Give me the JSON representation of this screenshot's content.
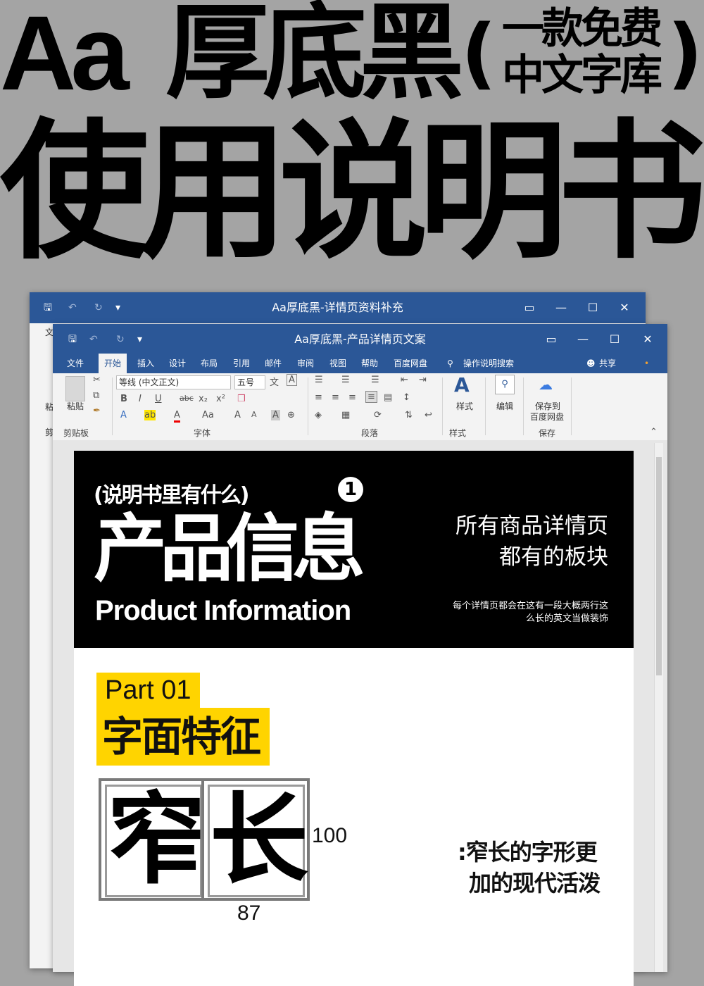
{
  "hero": {
    "aa": "Aa",
    "name": "厚底黑",
    "paren_left": "(",
    "paren_right": ")",
    "sub_line1": "一款免费",
    "sub_line2": "中文字库",
    "line2": "使用说明书"
  },
  "back_window": {
    "title": "Aa厚底黑-详情页资料补充",
    "left_labels": [
      "文",
      "粘",
      "剪"
    ]
  },
  "window": {
    "title": "Aa厚底黑-产品详情页文案",
    "controls": {
      "restore": "▭",
      "minimize": "—",
      "maximize": "☐",
      "close": "✕"
    },
    "quick_access": {
      "save": "🖫",
      "undo": "↶",
      "redo": "↻",
      "more": "▾"
    }
  },
  "menu": {
    "items": [
      "文件",
      "开始",
      "插入",
      "设计",
      "布局",
      "引用",
      "邮件",
      "审阅",
      "视图",
      "帮助",
      "百度网盘"
    ],
    "search": "操作说明搜索",
    "share": "共享"
  },
  "ribbon": {
    "paste": "粘贴",
    "clipboard": "剪贴板",
    "font_name": "等线 (中文正文)",
    "font_size": "五号",
    "font_group": "字体",
    "paragraph_group": "段落",
    "styles": "样式",
    "styles_group": "样式",
    "edit": "编辑",
    "save_to": "保存到",
    "baidu": "百度网盘",
    "save_group": "保存",
    "format_buttons": [
      "B",
      "I",
      "U",
      "abc",
      "x₂",
      "x²"
    ],
    "font_buttons": [
      "A",
      "ab",
      "A",
      "Aa",
      "A",
      "A",
      "A",
      "⊕"
    ]
  },
  "document": {
    "banner": {
      "question": "(说明书里有什么)",
      "number": "1",
      "title": "产品信息",
      "english": "Product Information",
      "right_line1": "所有商品详情页",
      "right_line2": "都有的板块",
      "small_line1": "每个详情页都会在这有一段大概两行这",
      "small_line2": "么长的英文当做装饰"
    },
    "part_en": "Part 01",
    "part_cn": "字面特征",
    "chars": [
      "窄",
      "长"
    ],
    "width_value": "100",
    "height_value": "87",
    "desc_line1": ":窄长的字形更",
    "desc_line2": "加的现代活泼"
  },
  "colors": {
    "title_bar": "#2b5797",
    "highlight": "#ffd400",
    "background": "#a4a4a4"
  }
}
